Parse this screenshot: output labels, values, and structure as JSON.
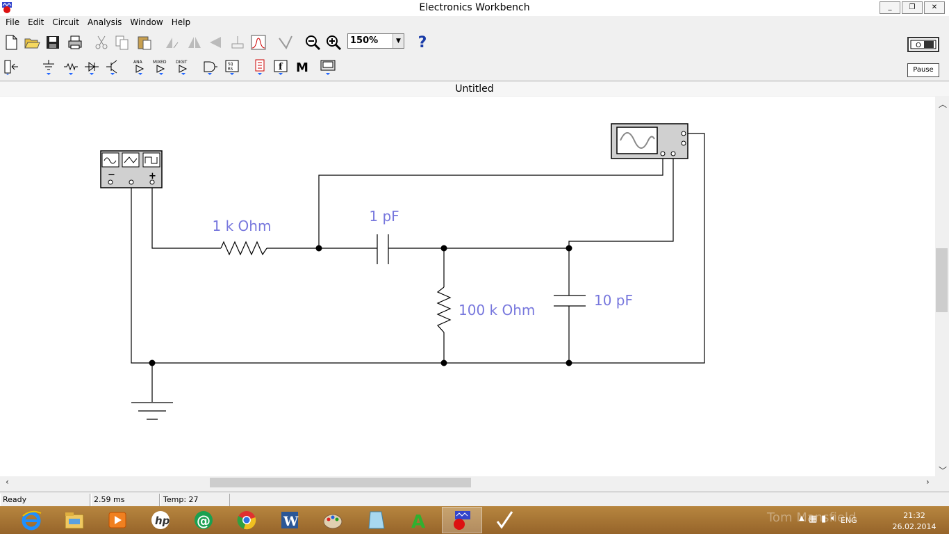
{
  "window": {
    "title": "Electronics Workbench",
    "minimize": "_",
    "restore": "❐",
    "close": "✕"
  },
  "menu": [
    "File",
    "Edit",
    "Circuit",
    "Analysis",
    "Window",
    "Help"
  ],
  "toolbar": {
    "zoom": "150%",
    "help": "?"
  },
  "parts_bin": [
    "ANA",
    "MIXED",
    "DIGIT",
    "M"
  ],
  "pause_label": "Pause",
  "document": {
    "title": "Untitled"
  },
  "circuit": {
    "r1": "1 k Ohm",
    "c1": "1 pF",
    "r2": "100 k Ohm",
    "c2": "10 pF",
    "generator_minus": "−",
    "generator_plus": "+"
  },
  "status": {
    "state": "Ready",
    "time": "2.59 ms",
    "temp": "Temp:  27"
  },
  "taskbar": {
    "watermark": "Tom Mansfield",
    "lang": "ENG",
    "clock": "21:32",
    "date": "26.02.2014"
  },
  "colors": {
    "label": "#7777dd",
    "taskbar": "#a8763a"
  }
}
